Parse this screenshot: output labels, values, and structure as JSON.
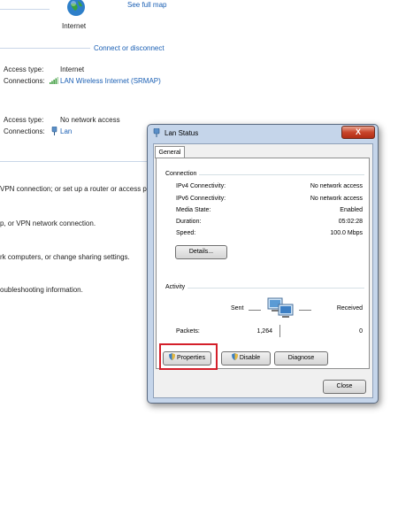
{
  "network_map": {
    "internet_label": "Internet",
    "see_full_map": "See full map",
    "connect_or_disconnect": "Connect or disconnect"
  },
  "active_networks": [
    {
      "access_type_label": "Access type:",
      "access_type_value": "Internet",
      "connections_label": "Connections:",
      "connection_name": "LAN Wireless Internet (SRMAP)",
      "connection_icon": "wireless-signal-icon"
    },
    {
      "access_type_label": "Access type:",
      "access_type_value": "No network access",
      "connections_label": "Connections:",
      "connection_name": "Lan",
      "connection_icon": "ethernet-icon"
    }
  ],
  "settings_tasks": [
    "VPN connection; or set up a router or access p",
    "p, or VPN network connection.",
    "rk computers, or change sharing settings.",
    "oubleshooting information."
  ],
  "dialog": {
    "title": "Lan Status",
    "close_label": "X",
    "tab_general": "General",
    "connection_group": "Connection",
    "rows": [
      {
        "label": "IPv4 Connectivity:",
        "value": "No network access"
      },
      {
        "label": "IPv6 Connectivity:",
        "value": "No network access"
      },
      {
        "label": "Media State:",
        "value": "Enabled"
      },
      {
        "label": "Duration:",
        "value": "05:02:28"
      },
      {
        "label": "Speed:",
        "value": "100.0 Mbps"
      }
    ],
    "details_button": "Details...",
    "activity_group": "Activity",
    "sent_label": "Sent",
    "received_label": "Received",
    "packets_label": "Packets:",
    "packets_sent": "1,264",
    "packets_received": "0",
    "properties_button": "Properties",
    "disable_button": "Disable",
    "diagnose_button": "Diagnose",
    "close_button": "Close"
  },
  "colors": {
    "link": "#1a5fb4",
    "highlight_box": "#d41f2a",
    "dialog_frame": "#c5d5ea",
    "close_button": "#c9452b"
  }
}
